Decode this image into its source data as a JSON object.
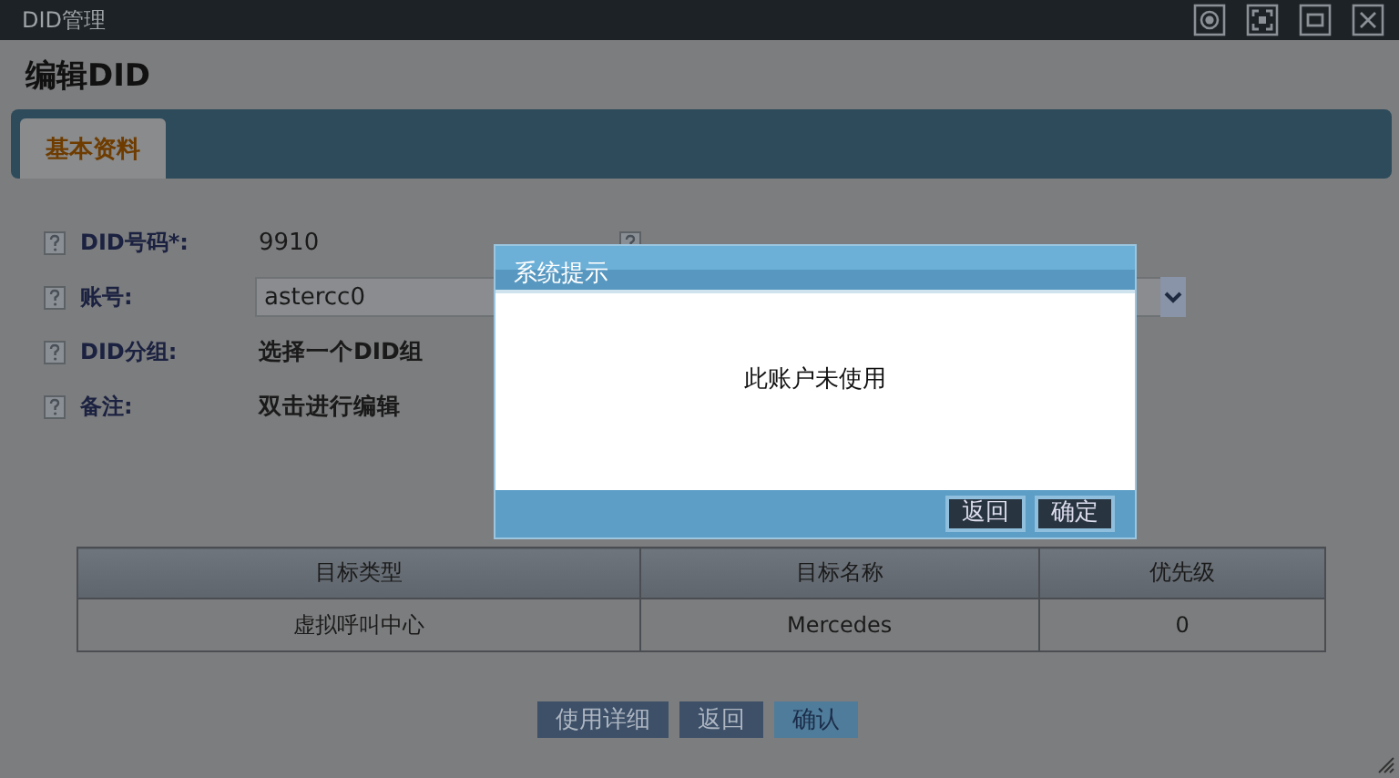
{
  "window": {
    "title": "DID管理"
  },
  "heading": "编辑DID",
  "tabs": [
    {
      "label": "基本资料",
      "selected": true
    }
  ],
  "form": [
    {
      "label": "DID号码*:",
      "kind": "text",
      "value": "9910"
    },
    {
      "label": "账号:",
      "kind": "select",
      "value": "astercc0"
    },
    {
      "label": "DID分组:",
      "kind": "text",
      "value": "选择一个DID组"
    },
    {
      "label": "备注:",
      "kind": "text",
      "value": "双击进行编辑"
    }
  ],
  "table": {
    "columns": [
      "目标类型",
      "目标名称",
      "优先级"
    ],
    "rows": [
      [
        "虚拟呼叫中心",
        "Mercedes",
        "0"
      ]
    ]
  },
  "buttons": [
    {
      "label": "使用详细",
      "kind": "secondary"
    },
    {
      "label": "返回",
      "kind": "secondary"
    },
    {
      "label": "确认",
      "kind": "primary"
    }
  ],
  "dialog": {
    "title": "系统提示",
    "message": "此账户未使用",
    "buttons": [
      "返回",
      "确定"
    ]
  }
}
